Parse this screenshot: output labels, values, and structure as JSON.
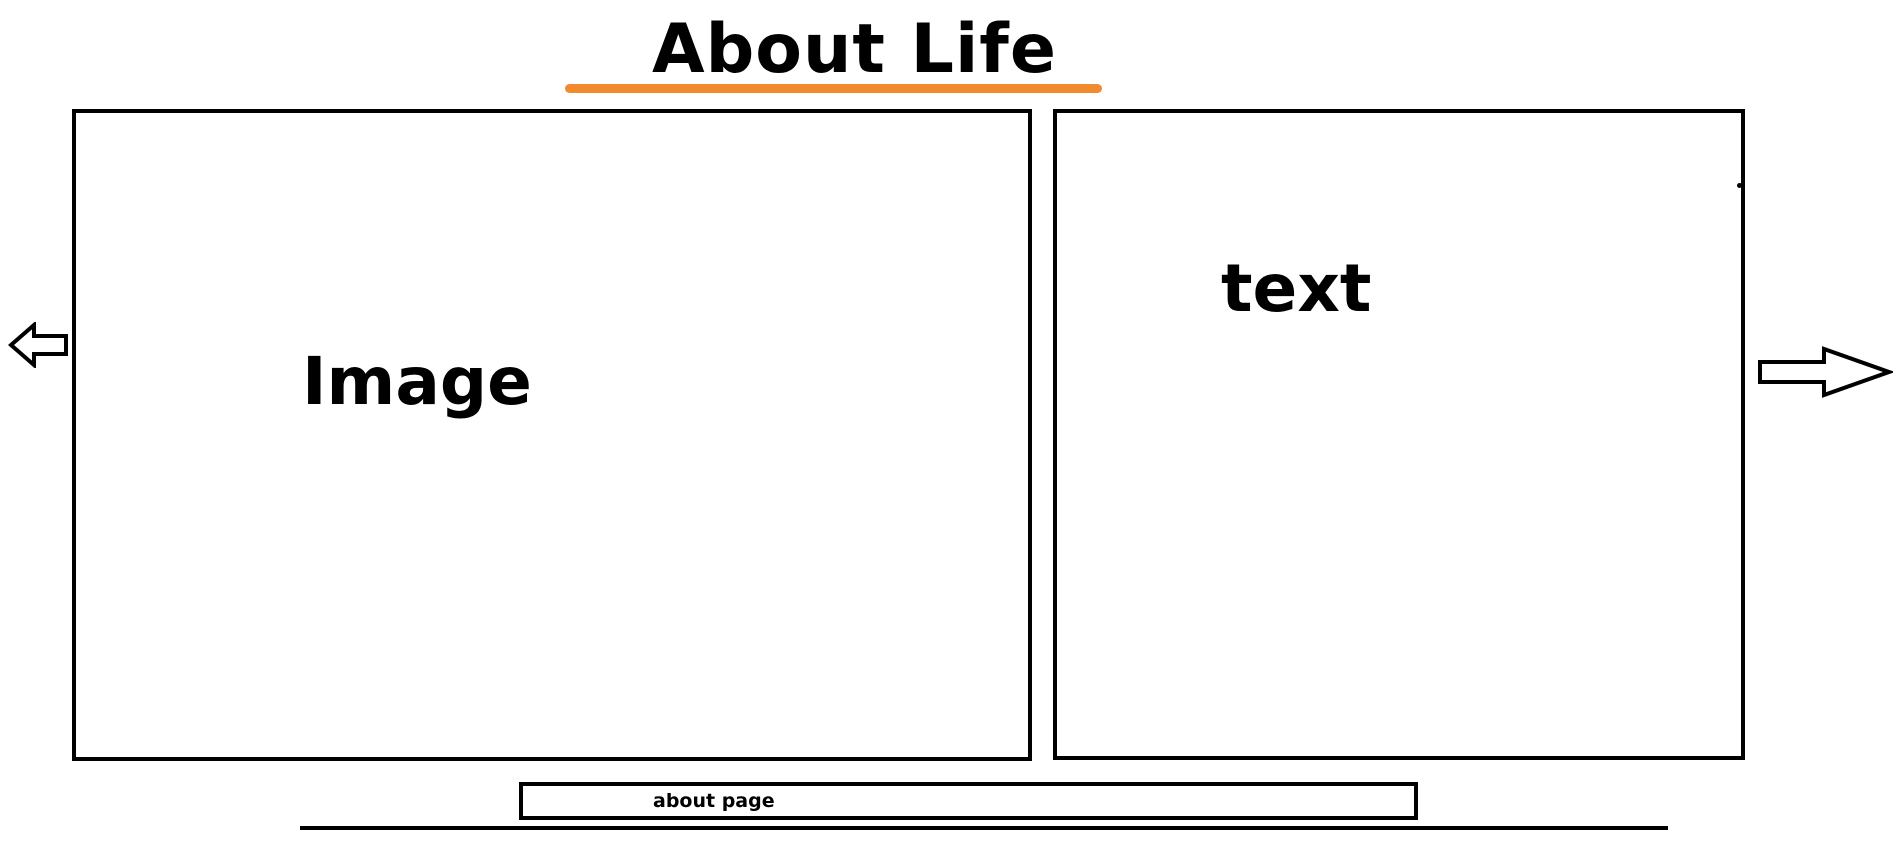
{
  "header": {
    "title": "About Life",
    "accent_color": "#f28a2e"
  },
  "main": {
    "image_panel": {
      "label": "Image"
    },
    "text_panel": {
      "label": "text"
    }
  },
  "navigation": {
    "prev_icon": "left-arrow-icon",
    "next_icon": "right-arrow-icon"
  },
  "footer": {
    "about_label": "about page"
  }
}
